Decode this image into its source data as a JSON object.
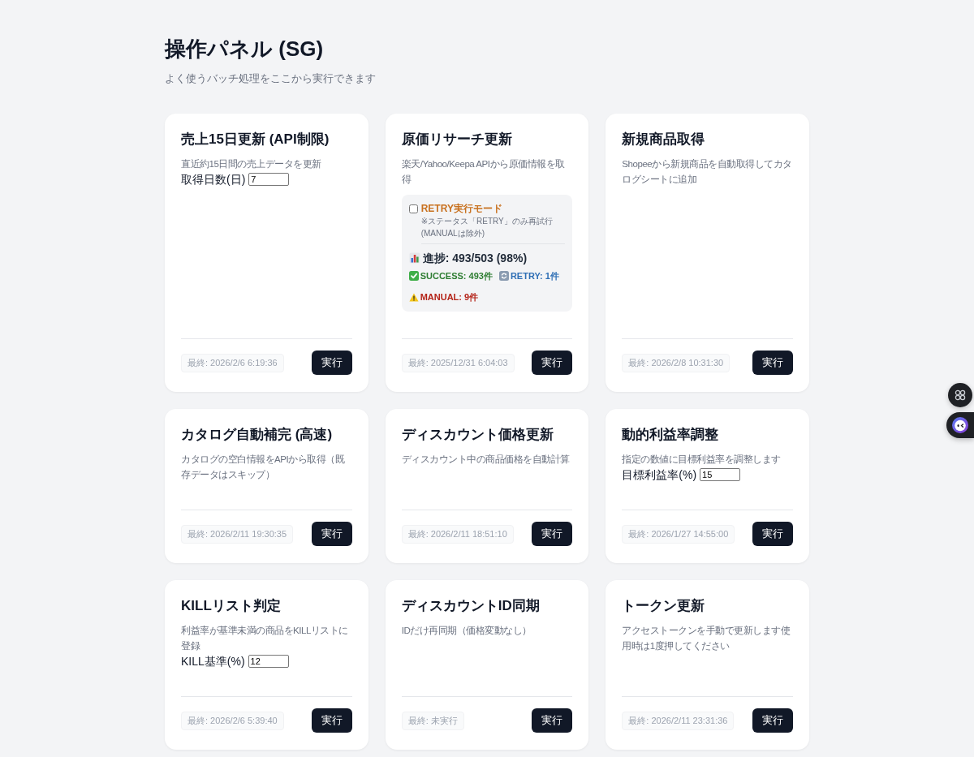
{
  "page": {
    "title": "操作パネル (SG)",
    "subtitle": "よく使うバッチ処理をここから実行できます"
  },
  "cards": [
    {
      "kind": "input",
      "title": "売上15日更新 (API制限)",
      "description": "直近約15日間の売上データを更新",
      "input": {
        "label": "取得日数(日)",
        "value": "7"
      },
      "last_run": "最終: 2026/2/6 6:19:36",
      "button": "実行"
    },
    {
      "kind": "research",
      "title": "原価リサーチ更新",
      "description": "楽天/Yahoo/Keepa APIから原価情報を取得",
      "retry": {
        "label": "RETRY実行モード",
        "checked": false,
        "note": "※ステータス「RETRY」のみ再試行 (MANUALは除外)"
      },
      "progress": "進捗: 493/503 (98%)",
      "stats": [
        {
          "kind": "success",
          "text": "SUCCESS: 493件"
        },
        {
          "kind": "retry",
          "text": "RETRY: 1件"
        },
        {
          "kind": "manual",
          "text": "MANUAL: 9件"
        }
      ],
      "last_run": "最終: 2025/12/31 6:04:03",
      "button": "実行"
    },
    {
      "kind": "basic",
      "title": "新規商品取得",
      "description": "Shopeeから新規商品を自動取得してカタログシートに追加",
      "last_run": "最終: 2026/2/8 10:31:30",
      "button": "実行"
    },
    {
      "kind": "basic",
      "title": "カタログ自動補完 (高速)",
      "description": "カタログの空白情報をAPIから取得（既存データはスキップ）",
      "last_run": "最終: 2026/2/11 19:30:35",
      "button": "実行"
    },
    {
      "kind": "basic",
      "title": "ディスカウント価格更新",
      "description": "ディスカウント中の商品価格を自動計算",
      "last_run": "最終: 2026/2/11 18:51:10",
      "button": "実行"
    },
    {
      "kind": "input",
      "title": "動的利益率調整",
      "description": "指定の数値に目標利益率を調整します",
      "input": {
        "label": "目標利益率(%)",
        "value": "15"
      },
      "last_run": "最終: 2026/1/27 14:55:00",
      "button": "実行"
    },
    {
      "kind": "input",
      "title": "KILLリスト判定",
      "description": "利益率が基準未満の商品をKILLリストに登録",
      "input": {
        "label": "KILL基準(%)",
        "value": "12"
      },
      "last_run": "最終: 2026/2/6 5:39:40",
      "button": "実行"
    },
    {
      "kind": "basic",
      "title": "ディスカウントID同期",
      "description": "IDだけ再同期（価格変動なし）",
      "last_run": "最終: 未実行",
      "button": "実行"
    },
    {
      "kind": "basic",
      "title": "トークン更新",
      "description": "アクセストークンを手動で更新します使用時は1度押してください",
      "last_run": "最終: 2026/2/11 23:31:36",
      "button": "実行"
    }
  ],
  "side_buttons": [
    {
      "kind": "shortcuts"
    },
    {
      "kind": "assistant"
    }
  ]
}
